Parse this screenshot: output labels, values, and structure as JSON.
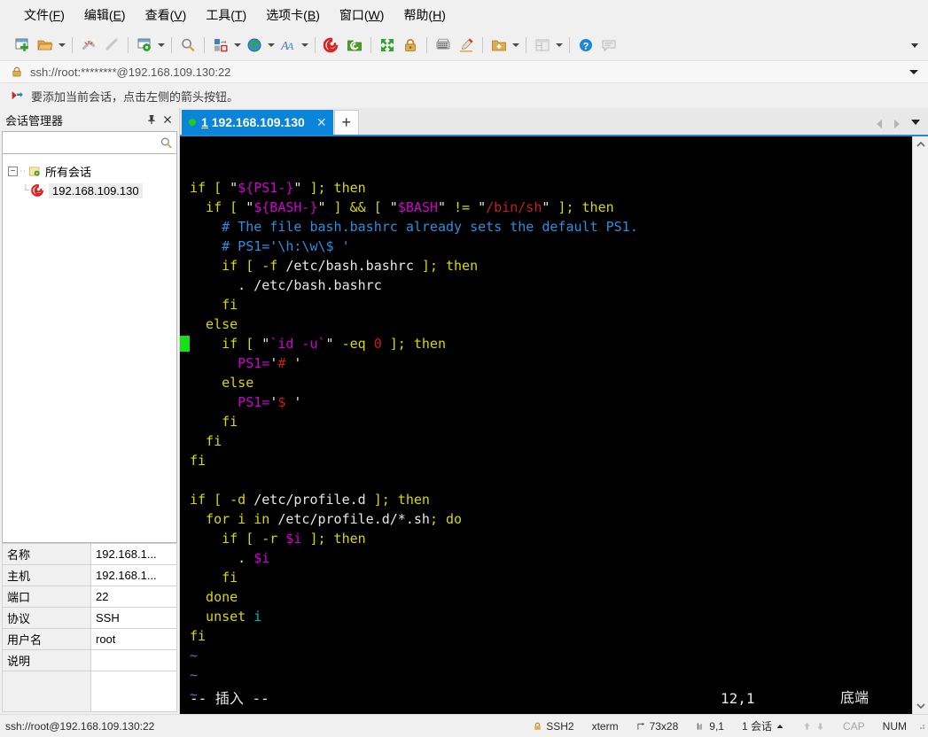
{
  "window": {
    "title": "192.168.109.130"
  },
  "menubar": {
    "items": [
      {
        "label": "文件(F)",
        "name": "menu-file"
      },
      {
        "label": "编辑(E)",
        "name": "menu-edit"
      },
      {
        "label": "查看(V)",
        "name": "menu-view"
      },
      {
        "label": "工具(T)",
        "name": "menu-tools"
      },
      {
        "label": "选项卡(B)",
        "name": "menu-tabs"
      },
      {
        "label": "窗口(W)",
        "name": "menu-window"
      },
      {
        "label": "帮助(H)",
        "name": "menu-help"
      }
    ]
  },
  "toolbar": {
    "buttons": [
      {
        "name": "new-session-icon"
      },
      {
        "name": "open-folder-icon"
      },
      {
        "name": "disconnect-icon"
      },
      {
        "name": "connect-icon"
      },
      {
        "name": "session-options-icon"
      },
      {
        "name": "find-icon"
      },
      {
        "name": "transfer-icon"
      },
      {
        "name": "globe-icon"
      },
      {
        "name": "font-icon"
      },
      {
        "name": "log-session-icon"
      },
      {
        "name": "sftp-icon"
      },
      {
        "name": "fullscreen-icon"
      },
      {
        "name": "lock-icon"
      },
      {
        "name": "keymap-icon"
      },
      {
        "name": "highlight-icon"
      },
      {
        "name": "add-folder-icon"
      },
      {
        "name": "tile-icon"
      },
      {
        "name": "help-icon"
      },
      {
        "name": "chat-icon"
      }
    ]
  },
  "address": {
    "value": "ssh://root:********@192.168.109.130:22",
    "lock_icon": "lock-icon"
  },
  "hint": {
    "text": "要添加当前会话，点击左侧的箭头按钮。",
    "icon": "red-arrow-icon"
  },
  "sidebar": {
    "title": "会话管理器",
    "pin_icon": "pin-icon",
    "close_icon": "close-icon",
    "search_placeholder": "",
    "search_icon": "search-icon",
    "tree": {
      "root_label": "所有会话",
      "root_toggle": "−",
      "children": [
        {
          "label": "192.168.109.130",
          "icon": "session-icon",
          "selected": true
        }
      ]
    },
    "properties": [
      {
        "key": "名称",
        "value": "192.168.1..."
      },
      {
        "key": "主机",
        "value": "192.168.1..."
      },
      {
        "key": "端口",
        "value": "22"
      },
      {
        "key": "协议",
        "value": "SSH"
      },
      {
        "key": "用户名",
        "value": "root"
      },
      {
        "key": "说明",
        "value": ""
      }
    ]
  },
  "tabs": {
    "items": [
      {
        "index": "1",
        "label": "192.168.109.130",
        "active": true,
        "close_label": "✕"
      }
    ],
    "new_tab_label": "+",
    "prev_icon": "triangle-left-icon",
    "next_icon": "triangle-right-icon",
    "menu_icon": "chevron-down-icon"
  },
  "terminal": {
    "lines": [
      [
        {
          "t": "if [ ",
          "c": "yellow"
        },
        {
          "t": "\"",
          "c": "white"
        },
        {
          "t": "${PS1-}",
          "c": "magenta"
        },
        {
          "t": "\"",
          "c": "white"
        },
        {
          "t": " ]; then",
          "c": "yellow"
        }
      ],
      [
        {
          "t": "  if [ ",
          "c": "yellow"
        },
        {
          "t": "\"",
          "c": "white"
        },
        {
          "t": "${BASH-}",
          "c": "magenta"
        },
        {
          "t": "\"",
          "c": "white"
        },
        {
          "t": " ] ",
          "c": "yellow"
        },
        {
          "t": "&&",
          "c": "yellow"
        },
        {
          "t": " [ ",
          "c": "yellow"
        },
        {
          "t": "\"",
          "c": "white"
        },
        {
          "t": "$BASH",
          "c": "magenta"
        },
        {
          "t": "\"",
          "c": "white"
        },
        {
          "t": " != ",
          "c": "yellow"
        },
        {
          "t": "\"",
          "c": "white"
        },
        {
          "t": "/bin/sh",
          "c": "red"
        },
        {
          "t": "\"",
          "c": "white"
        },
        {
          "t": " ]; then",
          "c": "yellow"
        }
      ],
      [
        {
          "t": "    # The file bash.bashrc already sets the default PS1.",
          "c": "blue"
        }
      ],
      [
        {
          "t": "    # PS1='\\h:\\w\\$ '",
          "c": "blue"
        }
      ],
      [
        {
          "t": "    if [ -f ",
          "c": "yellow"
        },
        {
          "t": "/etc/bash.bashrc",
          "c": "white"
        },
        {
          "t": " ]; then",
          "c": "yellow"
        }
      ],
      [
        {
          "t": "      . ",
          "c": "white"
        },
        {
          "t": "/etc/bash.bashrc",
          "c": "white"
        }
      ],
      [
        {
          "t": "    fi",
          "c": "yellow"
        }
      ],
      [
        {
          "t": "  else",
          "c": "yellow"
        }
      ],
      [
        {
          "t": "    if [ ",
          "c": "yellow"
        },
        {
          "t": "\"",
          "c": "white"
        },
        {
          "t": "`id -u`",
          "c": "magenta"
        },
        {
          "t": "\"",
          "c": "white"
        },
        {
          "t": " -eq ",
          "c": "yellow"
        },
        {
          "t": "0",
          "c": "red"
        },
        {
          "t": " ]; then",
          "c": "yellow"
        }
      ],
      [
        {
          "t": "      PS1=",
          "c": "magenta"
        },
        {
          "t": "'",
          "c": "white"
        },
        {
          "t": "#",
          "c": "red"
        },
        {
          "t": " '",
          "c": "white"
        }
      ],
      [
        {
          "t": "    else",
          "c": "yellow"
        }
      ],
      [
        {
          "t": "      PS1=",
          "c": "magenta"
        },
        {
          "t": "'",
          "c": "white"
        },
        {
          "t": "$",
          "c": "red"
        },
        {
          "t": " '",
          "c": "white"
        }
      ],
      [
        {
          "t": "    fi",
          "c": "yellow"
        }
      ],
      [
        {
          "t": "  fi",
          "c": "yellow"
        }
      ],
      [
        {
          "t": "fi",
          "c": "yellow"
        }
      ],
      [
        {
          "t": "",
          "c": "white"
        }
      ],
      [
        {
          "t": "if [ -d ",
          "c": "yellow"
        },
        {
          "t": "/etc/profile.d",
          "c": "white"
        },
        {
          "t": " ]; then",
          "c": "yellow"
        }
      ],
      [
        {
          "t": "  for i in ",
          "c": "yellow"
        },
        {
          "t": "/etc/profile.d/*.sh",
          "c": "white"
        },
        {
          "t": "; do",
          "c": "yellow"
        }
      ],
      [
        {
          "t": "    if [ -r ",
          "c": "yellow"
        },
        {
          "t": "$i",
          "c": "magenta"
        },
        {
          "t": " ]; then",
          "c": "yellow"
        }
      ],
      [
        {
          "t": "      . ",
          "c": "white"
        },
        {
          "t": "$i",
          "c": "magenta"
        }
      ],
      [
        {
          "t": "    fi",
          "c": "yellow"
        }
      ],
      [
        {
          "t": "  done",
          "c": "yellow"
        }
      ],
      [
        {
          "t": "  unset ",
          "c": "yellow"
        },
        {
          "t": "i",
          "c": "cyan"
        }
      ],
      [
        {
          "t": "fi",
          "c": "yellow"
        }
      ],
      [
        {
          "t": "~",
          "c": "tilde"
        }
      ],
      [
        {
          "t": "~",
          "c": "tilde"
        }
      ],
      [
        {
          "t": "~",
          "c": "tilde"
        }
      ]
    ],
    "cursor_line": 8,
    "status": {
      "mode": "-- 插入 --",
      "position": "12,1",
      "scroll": "底端"
    }
  },
  "statusbar": {
    "connection": "ssh://root@192.168.109.130:22",
    "security": "SSH2",
    "security_icon": "lock-icon",
    "emulation": "xterm",
    "size": "73x28",
    "size_icon": "resize-icon",
    "cursor": "9,1",
    "cursor_icon": "cursor-icon",
    "sessions": "1 会话",
    "sessions_arrow": "triangle-up-icon",
    "upload_icon": "arrow-up-icon",
    "download_icon": "arrow-down-icon",
    "cap": "CAP",
    "num": "NUM"
  },
  "colors": {
    "accent": "#0a84d8",
    "tab_active_bg": "#0a84d8",
    "terminal_bg": "#000000",
    "terminal_yellow": "#d8d800",
    "terminal_magenta": "#d000d0",
    "terminal_blue": "#2a8fe0",
    "terminal_red": "#c81e1e",
    "terminal_cyan": "#00b4b4",
    "cursor_green": "#18e018",
    "status_dot_green": "#22c91f"
  }
}
